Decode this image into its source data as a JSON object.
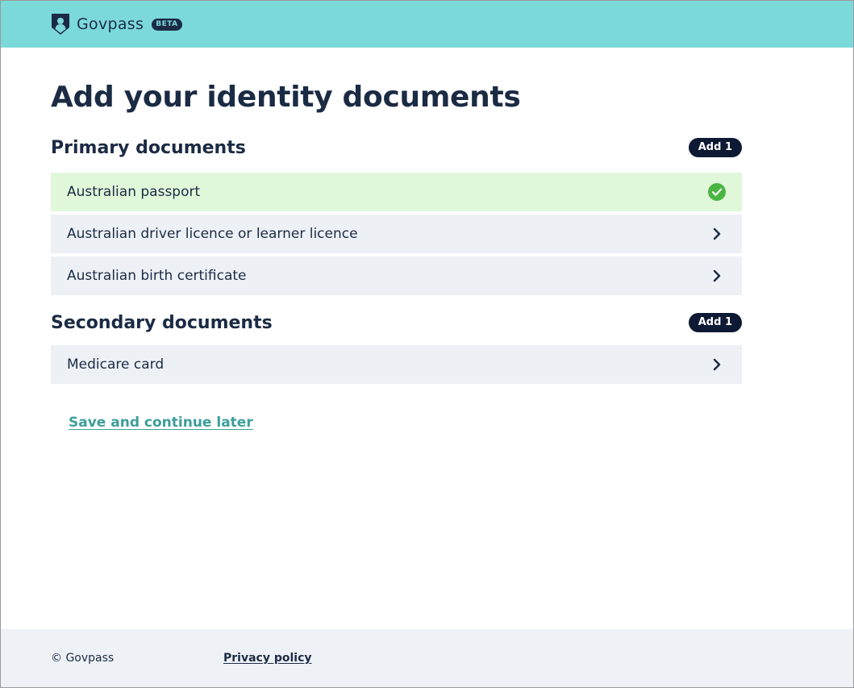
{
  "header": {
    "brand_name": "Govpass",
    "beta_label": "BETA",
    "logo_icon": "shield-person-icon"
  },
  "page": {
    "title": "Add your identity documents"
  },
  "primary": {
    "title": "Primary documents",
    "badge": "Add 1",
    "items": [
      {
        "label": "Australian passport",
        "status": "complete",
        "icon": "check-circle-icon"
      },
      {
        "label": "Australian driver licence or learner licence",
        "status": "pending",
        "icon": "chevron-right-icon"
      },
      {
        "label": "Australian birth certificate",
        "status": "pending",
        "icon": "chevron-right-icon"
      }
    ]
  },
  "secondary": {
    "title": "Secondary documents",
    "badge": "Add 1",
    "items": [
      {
        "label": "Medicare card",
        "status": "pending",
        "icon": "chevron-right-icon"
      }
    ]
  },
  "actions": {
    "save_later": "Save and continue later"
  },
  "footer": {
    "copyright": "© Govpass",
    "privacy": "Privacy policy"
  },
  "colors": {
    "header_bg": "#7cd9d9",
    "primary_text": "#1b2b44",
    "complete_bg": "#e0f7da",
    "check_green": "#4bb543",
    "link_teal": "#3d9e99",
    "row_bg": "#edf1f5",
    "footer_bg": "#eef1f5"
  }
}
